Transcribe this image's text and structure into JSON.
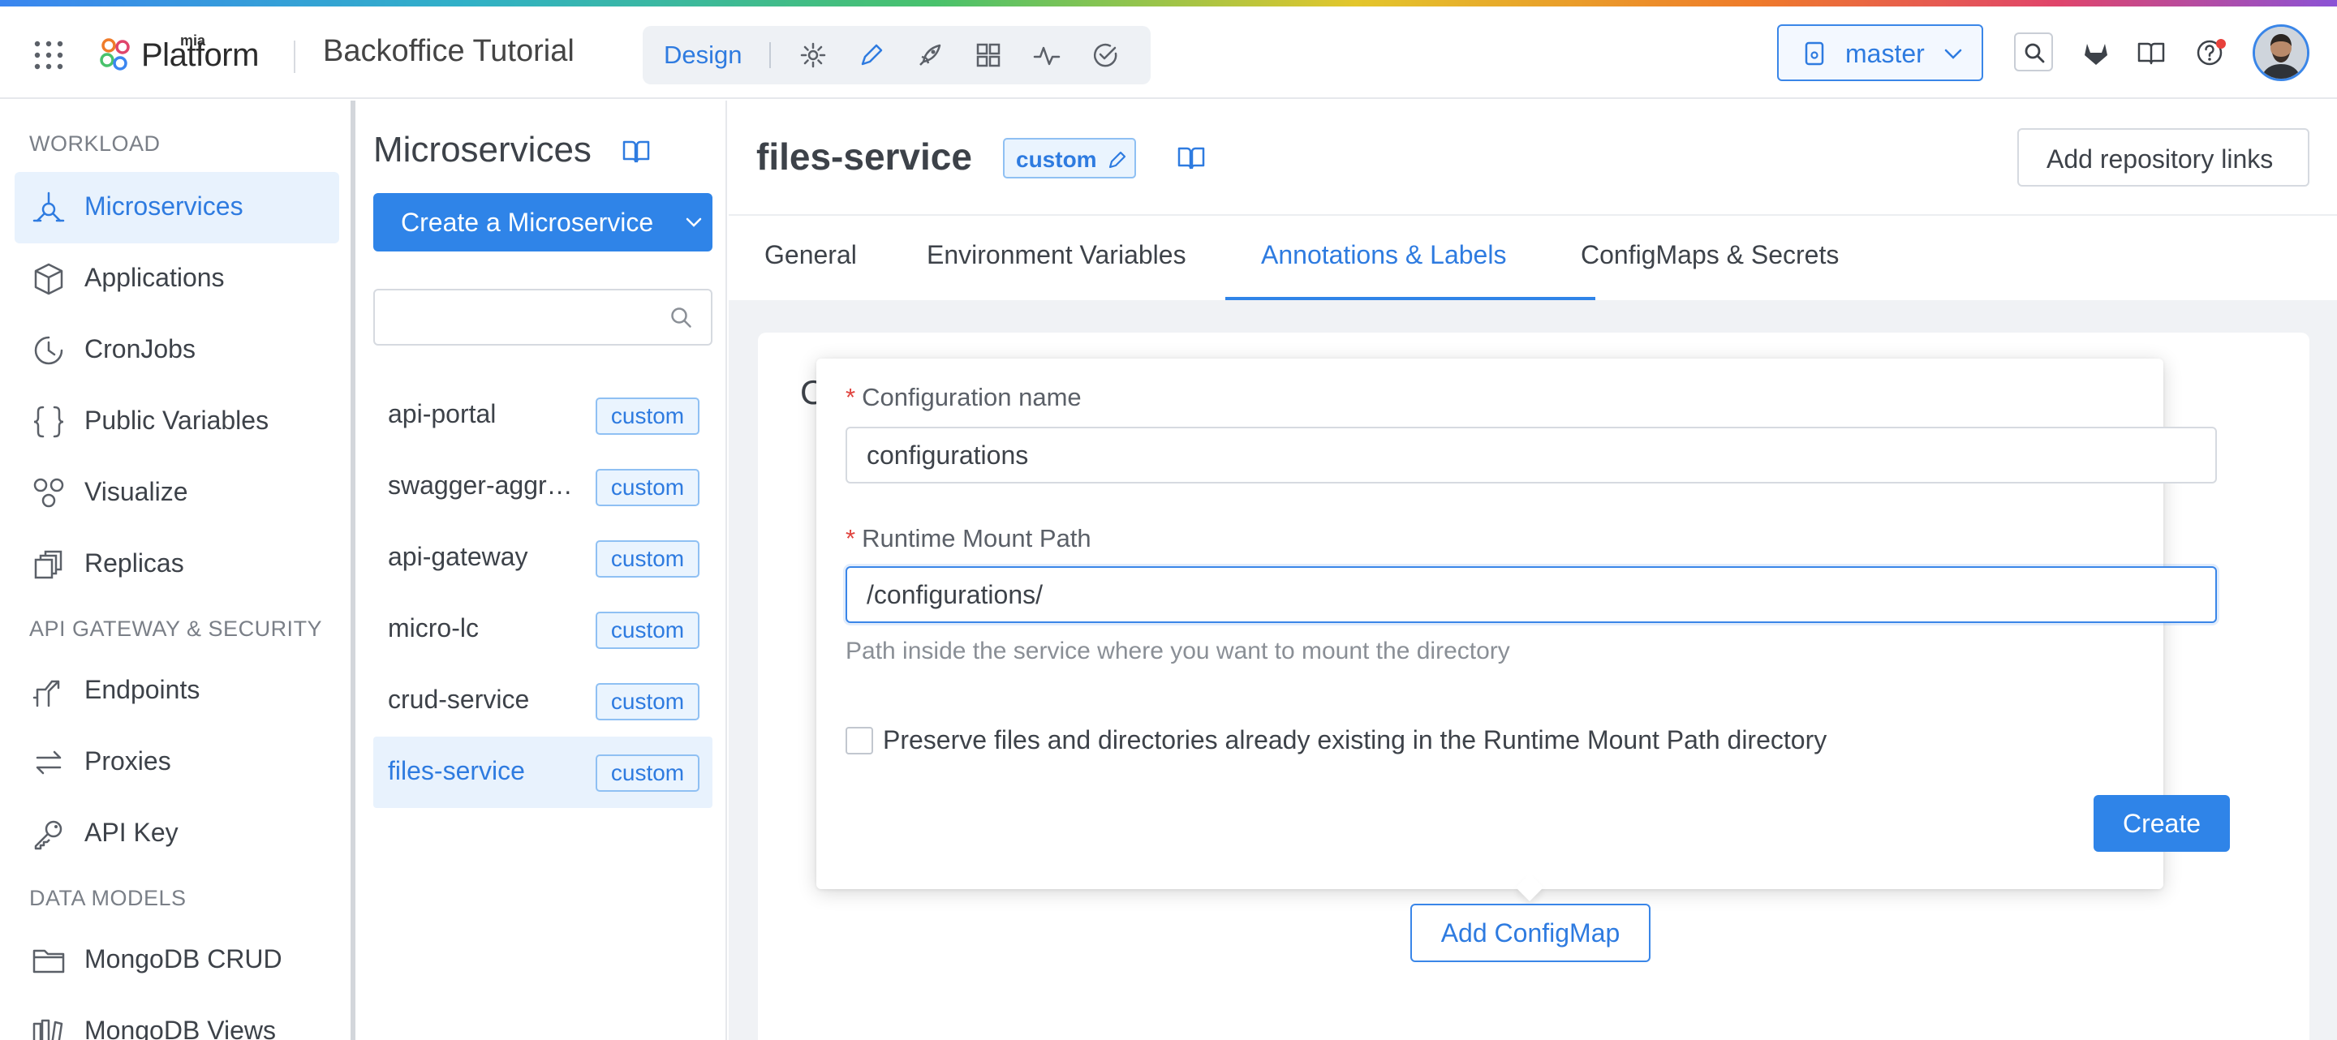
{
  "header": {
    "logo_small": "mia",
    "logo_text": "Platform",
    "project_title": "Backoffice Tutorial",
    "mode_label": "Design",
    "branch": "master"
  },
  "sidebar": {
    "sections": [
      {
        "title": "WORKLOAD",
        "items": [
          {
            "label": "Microservices",
            "icon": "microservices-icon",
            "active": true
          },
          {
            "label": "Applications",
            "icon": "cube-icon"
          },
          {
            "label": "CronJobs",
            "icon": "clock-icon"
          },
          {
            "label": "Public Variables",
            "icon": "braces-icon"
          },
          {
            "label": "Visualize",
            "icon": "nodes-icon"
          },
          {
            "label": "Replicas",
            "icon": "copies-icon"
          }
        ]
      },
      {
        "title": "API GATEWAY & SECURITY",
        "items": [
          {
            "label": "Endpoints",
            "icon": "endpoint-icon"
          },
          {
            "label": "Proxies",
            "icon": "swap-icon"
          },
          {
            "label": "API Key",
            "icon": "key-icon"
          }
        ]
      },
      {
        "title": "DATA MODELS",
        "items": [
          {
            "label": "MongoDB CRUD",
            "icon": "folder-icon"
          },
          {
            "label": "MongoDB Views",
            "icon": "views-icon"
          }
        ]
      }
    ]
  },
  "microservices": {
    "title": "Microservices",
    "create_label": "Create a Microservice",
    "search_placeholder": "",
    "items": [
      {
        "name": "api-portal",
        "tag": "custom"
      },
      {
        "name": "swagger-aggregator",
        "tag": "custom"
      },
      {
        "name": "api-gateway",
        "tag": "custom"
      },
      {
        "name": "micro-lc",
        "tag": "custom"
      },
      {
        "name": "crud-service",
        "tag": "custom"
      },
      {
        "name": "files-service",
        "tag": "custom",
        "active": true
      }
    ]
  },
  "main": {
    "service_name": "files-service",
    "service_tag": "custom",
    "repo_button": "Add repository links",
    "tabs": [
      {
        "label": "General"
      },
      {
        "label": "Environment Variables"
      },
      {
        "label": "Annotations & Labels",
        "active": true
      },
      {
        "label": "ConfigMaps & Secrets"
      }
    ],
    "card_title_peek": "C",
    "form": {
      "config_name_label": "Configuration name",
      "config_name_value": "configurations",
      "mount_path_label": "Runtime Mount Path",
      "mount_path_value": "/configurations/",
      "mount_path_help": "Path inside the service where you want to mount the directory",
      "preserve_label": "Preserve files and directories already existing in the Runtime Mount Path directory",
      "preserve_checked": false,
      "required_mark": "*",
      "create_label": "Create"
    },
    "add_configmap_label": "Add ConfigMap"
  },
  "colors": {
    "accent": "#2f84e8",
    "active_bg": "#e8f2fd",
    "tag_border": "#8fc0f3",
    "required": "#e0433e"
  }
}
